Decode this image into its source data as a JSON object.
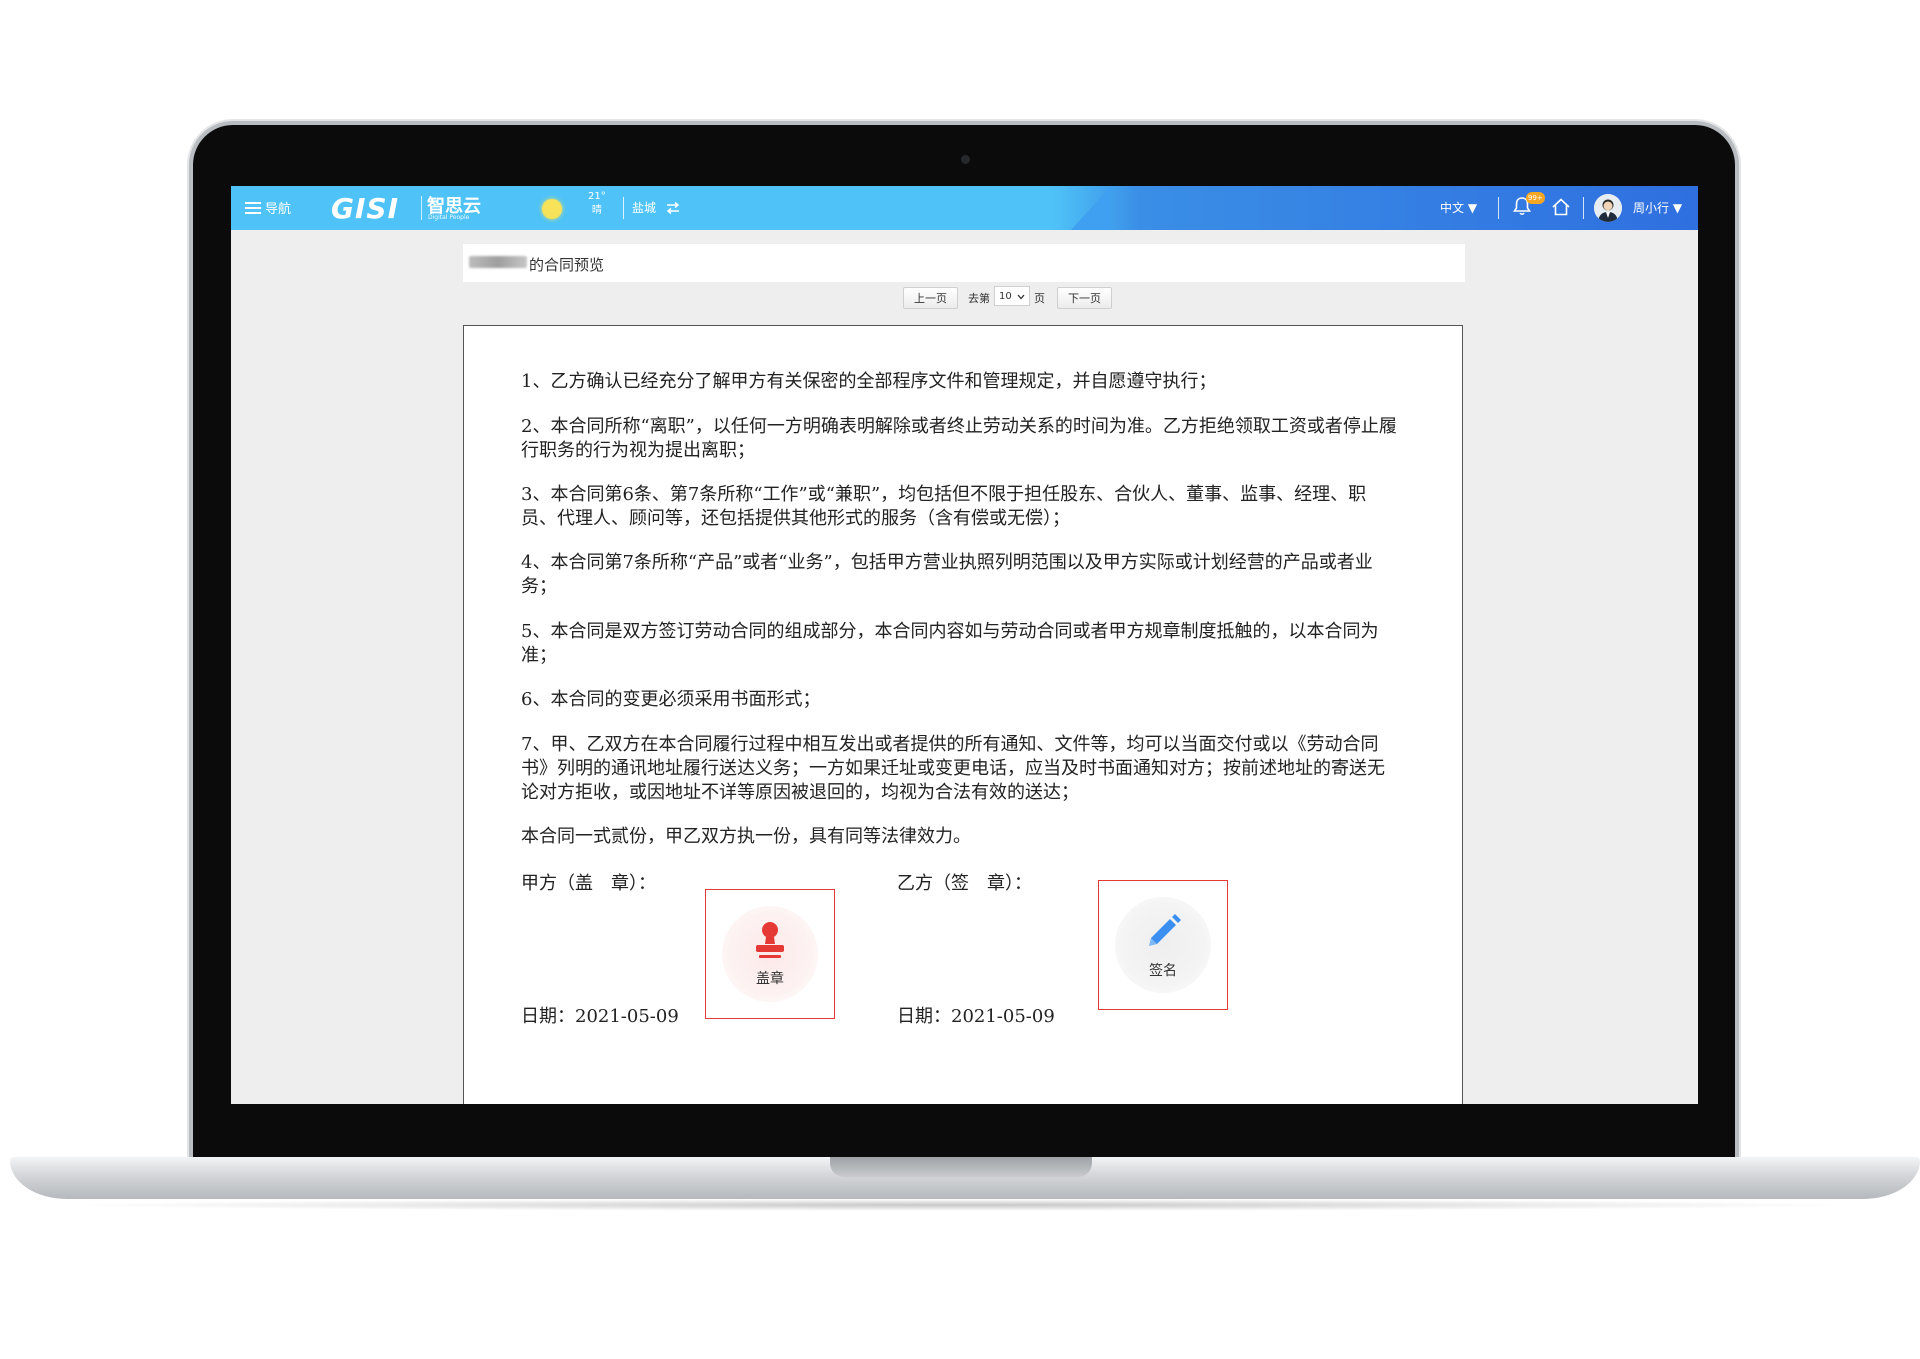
{
  "topbar": {
    "nav_label": "导航",
    "logo_text": "GISI",
    "logo_cn": "智思云",
    "logo_sub": "Digital People",
    "weather_temp": "21°",
    "weather_desc": "晴",
    "city": "盐城",
    "language": "中文 ▼",
    "notification_count": "99+",
    "user_name": "周小行 ▼"
  },
  "document": {
    "title_suffix": "的合同预览",
    "pager": {
      "prev_label": "上一页",
      "goto_prefix": "去第",
      "current_page": "10",
      "goto_suffix": "页",
      "next_label": "下一页"
    },
    "paragraphs": [
      "1、乙方确认已经充分了解甲方有关保密的全部程序文件和管理规定，并自愿遵守执行；",
      "2、本合同所称“离职”，以任何一方明确表明解除或者终止劳动关系的时间为准。乙方拒绝领取工资或者停止履行职务的行为视为提出离职；",
      "3、本合同第6条、第7条所称“工作”或“兼职”，均包括但不限于担任股东、合伙人、董事、监事、经理、职员、代理人、顾问等，还包括提供其他形式的服务（含有偿或无偿）；",
      "4、本合同第7条所称“产品”或者“业务”，包括甲方营业执照列明范围以及甲方实际或计划经营的产品或者业务；",
      "5、本合同是双方签订劳动合同的组成部分，本合同内容如与劳动合同或者甲方规章制度抵触的，以本合同为准；",
      "6、本合同的变更必须采用书面形式；",
      "7、甲、乙双方在本合同履行过程中相互发出或者提供的所有通知、文件等，均可以当面交付或以《劳动合同书》列明的通讯地址履行送达义务；一方如果迁址或变更电话，应当及时书面通知对方；按前述地址的寄送无论对方拒收，或因地址不详等原因被退回的，均视为合法有效的送达；",
      "本合同一式贰份，甲乙双方执一份，具有同等法律效力。"
    ],
    "party_a_label": "甲方（盖　章）：",
    "party_b_label": "乙方（签　章）：",
    "party_a_date": "日期：2021-05-09",
    "party_b_date": "日期：2021-05-09",
    "stamp_button_label": "盖章",
    "sign_button_label": "签名"
  },
  "colors": {
    "topbar_light": "#4fc3f7",
    "topbar_dark": "#2f6fe0",
    "action_border": "#e53935",
    "stamp_icon": "#e53935",
    "sign_icon": "#3b8ff0"
  }
}
